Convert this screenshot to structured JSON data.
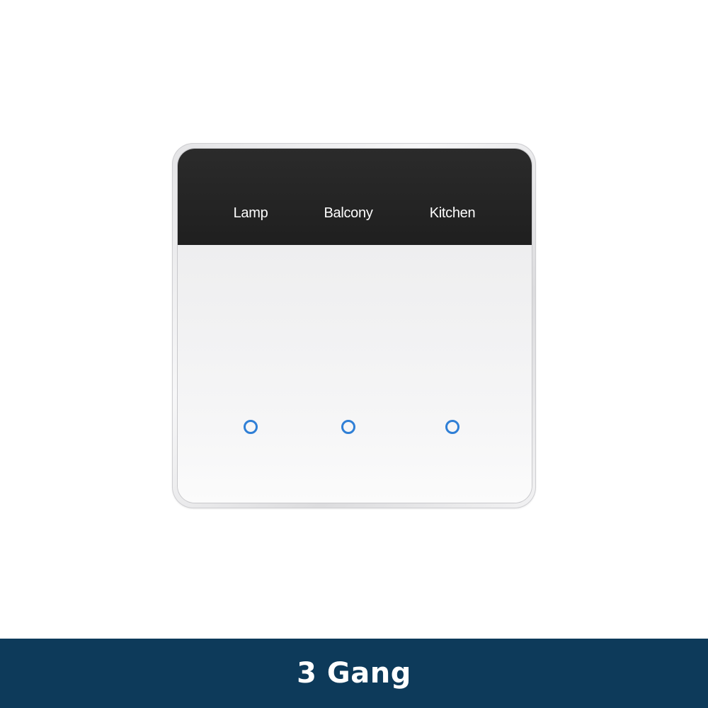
{
  "product": {
    "gangs": [
      {
        "label": "Lamp",
        "indicator_color": "#2f7fd6"
      },
      {
        "label": "Balcony",
        "indicator_color": "#2f7fd6"
      },
      {
        "label": "Kitchen",
        "indicator_color": "#2f7fd6"
      }
    ],
    "panel_top_color": "#222222",
    "panel_bottom_color": "#ececee"
  },
  "footer": {
    "title": "3 Gang",
    "background": "#0d3a5a"
  }
}
